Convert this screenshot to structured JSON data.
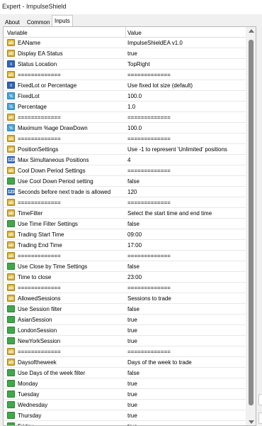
{
  "window": {
    "title": "Expert - ImpulseShield"
  },
  "tabs": [
    {
      "label": "About"
    },
    {
      "label": "Common"
    },
    {
      "label": "Inputs"
    }
  ],
  "table": {
    "headers": {
      "variable": "Variable",
      "value": "Value"
    },
    "rows": [
      {
        "icon": "ab",
        "name": "EAName",
        "value": "ImpulseShieldEA v1.0"
      },
      {
        "icon": "ab",
        "name": "Display EA Status",
        "value": "true"
      },
      {
        "icon": "enum",
        "name": "Status Location",
        "value": "TopRight"
      },
      {
        "icon": "ab",
        "name": "=============",
        "value": "============="
      },
      {
        "icon": "enum",
        "name": "FixedLot or Percentage",
        "value": "Use fixed lot size (default)"
      },
      {
        "icon": "flt",
        "name": "FixedLot",
        "value": "100.0"
      },
      {
        "icon": "flt",
        "name": "Percentage",
        "value": "1.0"
      },
      {
        "icon": "ab",
        "name": "=============",
        "value": "============="
      },
      {
        "icon": "flt",
        "name": "Maximum %age DrawDown",
        "value": "100.0"
      },
      {
        "icon": "ab",
        "name": "=============",
        "value": "============="
      },
      {
        "icon": "ab",
        "name": "PositionSettings",
        "value": "Use -1 to represent 'Unlimited' positions"
      },
      {
        "icon": "num",
        "name": "Max Simultaneous Positions",
        "value": "4"
      },
      {
        "icon": "ab",
        "name": "Cool Down Period Settings",
        "value": "============="
      },
      {
        "icon": "bool",
        "name": "Use Cool Down Period setting",
        "value": "false"
      },
      {
        "icon": "num",
        "name": "Seconds before next trade is allowed",
        "value": "120"
      },
      {
        "icon": "ab",
        "name": "=============",
        "value": "============="
      },
      {
        "icon": "ab",
        "name": "TimeFilter",
        "value": "Select the start time and end time"
      },
      {
        "icon": "bool",
        "name": "Use Time Filter Settings",
        "value": "false"
      },
      {
        "icon": "ab",
        "name": "Trading Start Time",
        "value": "09:00"
      },
      {
        "icon": "ab",
        "name": "Trading End Time",
        "value": "17:00"
      },
      {
        "icon": "ab",
        "name": "=============",
        "value": "============="
      },
      {
        "icon": "bool",
        "name": "Use Close by Time Settings",
        "value": "false"
      },
      {
        "icon": "ab",
        "name": "Time to close",
        "value": "23:00"
      },
      {
        "icon": "ab",
        "name": "=============",
        "value": "============="
      },
      {
        "icon": "ab",
        "name": "AllowedSessions",
        "value": "Sessions to trade"
      },
      {
        "icon": "bool",
        "name": "Use Session filter",
        "value": "false"
      },
      {
        "icon": "bool",
        "name": "AsianSession",
        "value": "true"
      },
      {
        "icon": "bool",
        "name": "LondonSession",
        "value": "true"
      },
      {
        "icon": "bool",
        "name": "NewYorkSession",
        "value": "true"
      },
      {
        "icon": "ab",
        "name": "=============",
        "value": "============="
      },
      {
        "icon": "ab",
        "name": "Daysoftheweek",
        "value": "Days of the week to trade"
      },
      {
        "icon": "bool",
        "name": "Use Days of the week filter",
        "value": "false"
      },
      {
        "icon": "bool",
        "name": "Monday",
        "value": "true"
      },
      {
        "icon": "bool",
        "name": "Tuesday",
        "value": "true"
      },
      {
        "icon": "bool",
        "name": "Wednesday",
        "value": "true"
      },
      {
        "icon": "bool",
        "name": "Thursday",
        "value": "true"
      },
      {
        "icon": "bool",
        "name": "Friday",
        "value": "true"
      }
    ]
  },
  "icons": {
    "ab": {
      "name": "string-type-icon",
      "glyph": "ab"
    },
    "num": {
      "name": "integer-type-icon",
      "glyph": "123"
    },
    "flt": {
      "name": "double-type-icon",
      "glyph": "½"
    },
    "bool": {
      "name": "bool-type-icon",
      "glyph": ""
    },
    "enum": {
      "name": "enum-type-icon",
      "glyph": "≡"
    }
  }
}
